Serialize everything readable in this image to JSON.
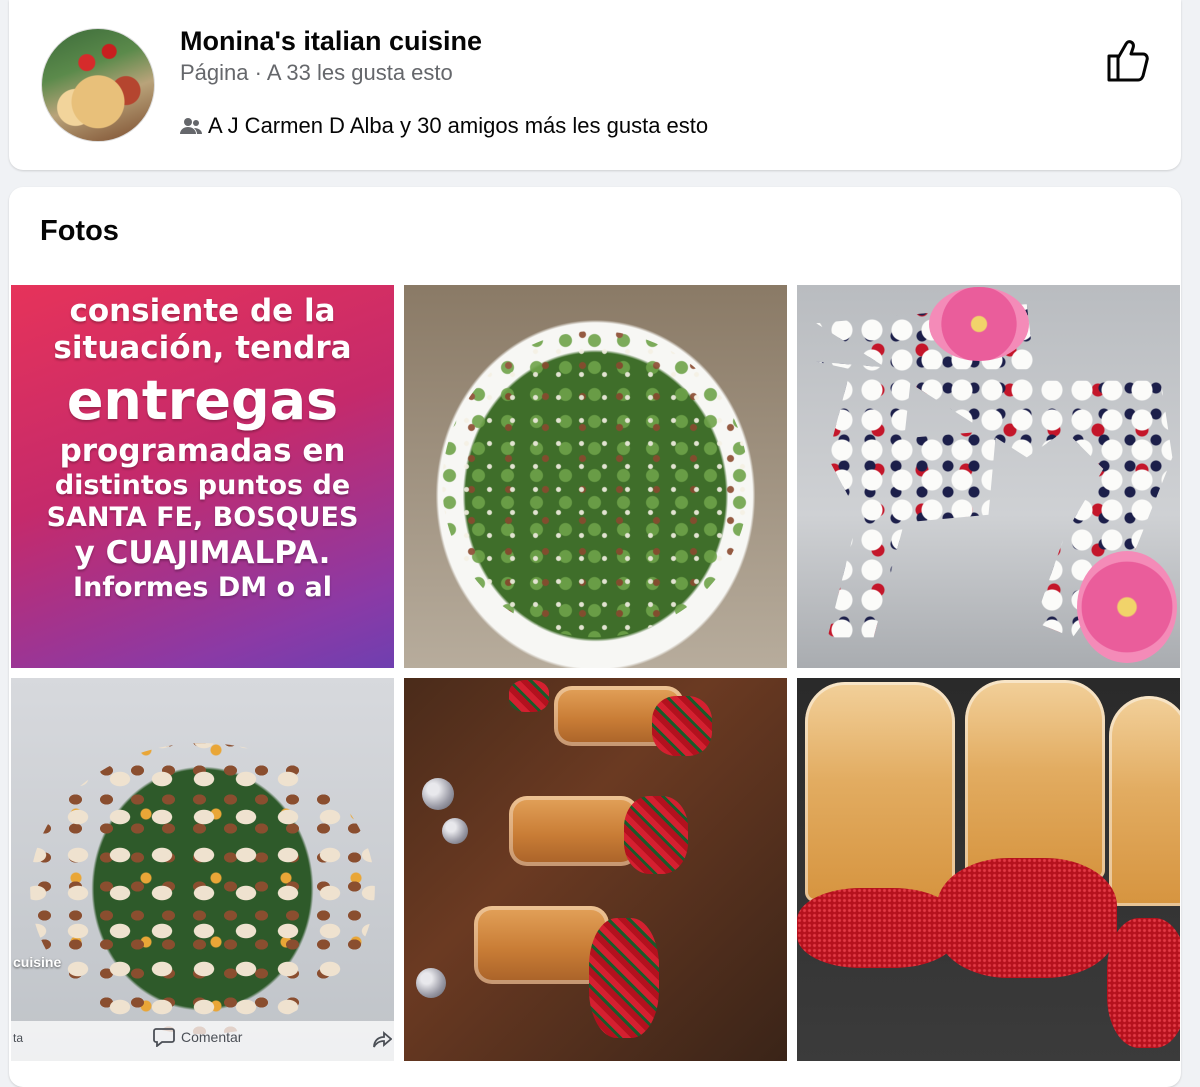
{
  "page": {
    "name": "Monina's italian cuisine",
    "meta": "Página · A 33 les gusta esto",
    "friends_likes": "A J Carmen D Alba y 30 amigos más les gusta esto"
  },
  "photos": {
    "title": "Fotos",
    "promo_lines": [
      "consiente de la",
      "situación, tendra",
      "entregas",
      "programadas en",
      "distintos puntos de",
      "SANTA FE, BOSQUES",
      "y CUAJIMALPA.",
      "Informes DM o al"
    ],
    "screenshot_watermark": "cuisine",
    "screenshot_comment_label": "Comentar",
    "screenshot_left_label": "ta"
  },
  "colors": {
    "page_bg": "#f0f2f5",
    "card_bg": "#ffffff",
    "secondary_text": "#65676b",
    "promo_gradient_start": "#e6335a",
    "promo_gradient_end": "#6f3fb0"
  },
  "icons": {
    "friends": "friends-icon",
    "like": "like-icon",
    "comment": "comment-icon",
    "share": "share-icon"
  }
}
